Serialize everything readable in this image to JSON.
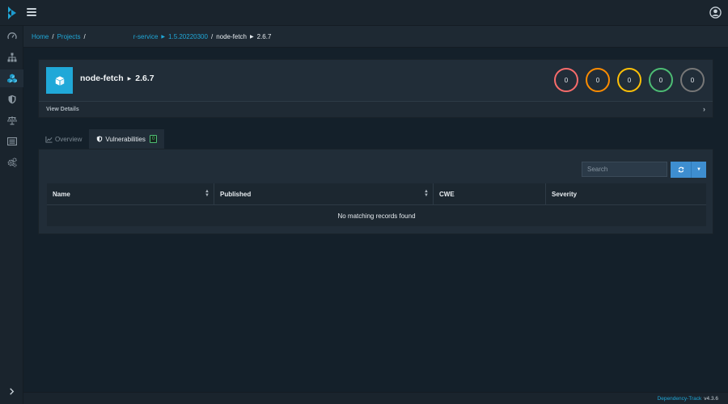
{
  "breadcrumb": {
    "home": "Home",
    "projects": "Projects",
    "project_name": "r-service",
    "project_version": "1.5.20220300",
    "component_name": "node-fetch",
    "component_version": "2.6.7"
  },
  "component": {
    "name": "node-fetch",
    "version": "2.6.7",
    "view_details": "View Details"
  },
  "severity_counts": [
    {
      "severity": "critical",
      "count": "0",
      "color": "#f86c6b"
    },
    {
      "severity": "high",
      "count": "0",
      "color": "#fd8c00"
    },
    {
      "severity": "medium",
      "count": "0",
      "color": "#ffc107"
    },
    {
      "severity": "low",
      "count": "0",
      "color": "#4dbd74"
    },
    {
      "severity": "unassigned",
      "count": "0",
      "color": "#777777"
    }
  ],
  "tabs": [
    {
      "label": "Overview",
      "icon": "chart-line-icon",
      "active": false
    },
    {
      "label": "Vulnerabilities",
      "icon": "shield-icon",
      "active": true,
      "badge": "0"
    }
  ],
  "search": {
    "placeholder": "Search"
  },
  "table": {
    "columns": [
      "Name",
      "Published",
      "CWE",
      "Severity"
    ],
    "empty_message": "No matching records found"
  },
  "sidebar": {
    "items": [
      "dashboard-icon",
      "projects-icon",
      "components-icon",
      "vulnerabilities-icon",
      "licenses-icon",
      "policy-icon",
      "admin-icon"
    ]
  },
  "footer": {
    "brand": "Dependency-Track",
    "version": "v4.3.6"
  }
}
